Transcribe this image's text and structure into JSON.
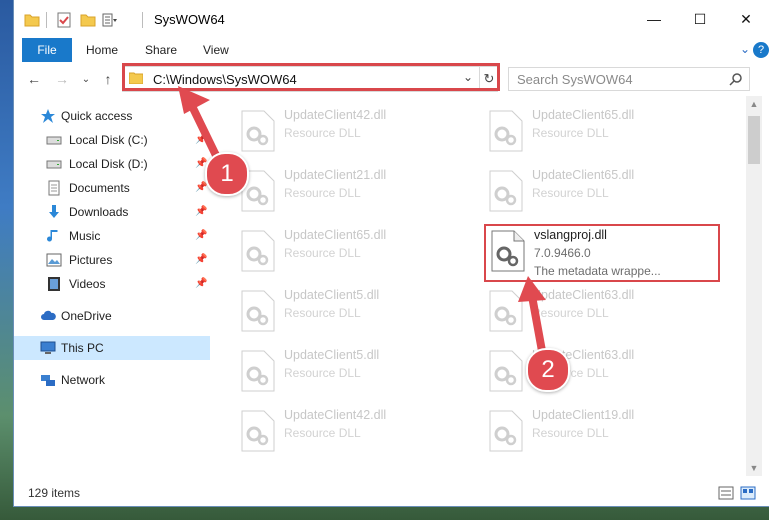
{
  "window": {
    "title": "SysWOW64",
    "controls": {
      "minimize": "—",
      "maximize": "☐",
      "close": "✕"
    }
  },
  "ribbon": {
    "tabs": [
      "File",
      "Home",
      "Share",
      "View"
    ],
    "help": "?"
  },
  "navigation": {
    "address": "C:\\Windows\\SysWOW64",
    "search_placeholder": "Search SysWOW64"
  },
  "sidebar": {
    "quick_access": "Quick access",
    "items": [
      {
        "label": "Local Disk (C:)",
        "icon": "drive-icon",
        "pinned": true
      },
      {
        "label": "Local Disk (D:)",
        "icon": "drive-icon",
        "pinned": true
      },
      {
        "label": "Documents",
        "icon": "documents-icon",
        "pinned": true
      },
      {
        "label": "Downloads",
        "icon": "downloads-icon",
        "pinned": true
      },
      {
        "label": "Music",
        "icon": "music-icon",
        "pinned": true
      },
      {
        "label": "Pictures",
        "icon": "pictures-icon",
        "pinned": true
      },
      {
        "label": "Videos",
        "icon": "videos-icon",
        "pinned": true
      }
    ],
    "onedrive": "OneDrive",
    "this_pc": "This PC",
    "network": "Network"
  },
  "files": [
    {
      "name": "UpdateClient42.dll",
      "type": "Resource DLL"
    },
    {
      "name": "UpdateClient65.dll",
      "type": "Resource DLL"
    },
    {
      "name": "UpdateClient21.dll",
      "type": "Resource DLL"
    },
    {
      "name": "UpdateClient65.dll",
      "type": "Resource DLL"
    },
    {
      "name": "UpdateClient65.dll",
      "type": "Resource DLL"
    },
    {
      "name": "vslangproj.dll",
      "type": "7.0.9466.0",
      "description": "The metadata wrappe..."
    },
    {
      "name": "UpdateClient5.dll",
      "type": "Resource DLL"
    },
    {
      "name": "UpdateClient63.dll",
      "type": "Resource DLL"
    },
    {
      "name": "UpdateClient5.dll",
      "type": "Resource DLL"
    },
    {
      "name": "UpdateClient63.dll",
      "type": "Resource DLL"
    },
    {
      "name": "UpdateClient42.dll",
      "type": "Resource DLL"
    },
    {
      "name": "UpdateClient19.dll",
      "type": "Resource DLL"
    }
  ],
  "status": {
    "item_count": "129 items"
  },
  "annotations": {
    "step1": "1",
    "step2": "2",
    "highlight_color": "#d9474b"
  },
  "colors": {
    "accent": "#1979ca",
    "selection": "#cce8ff"
  }
}
